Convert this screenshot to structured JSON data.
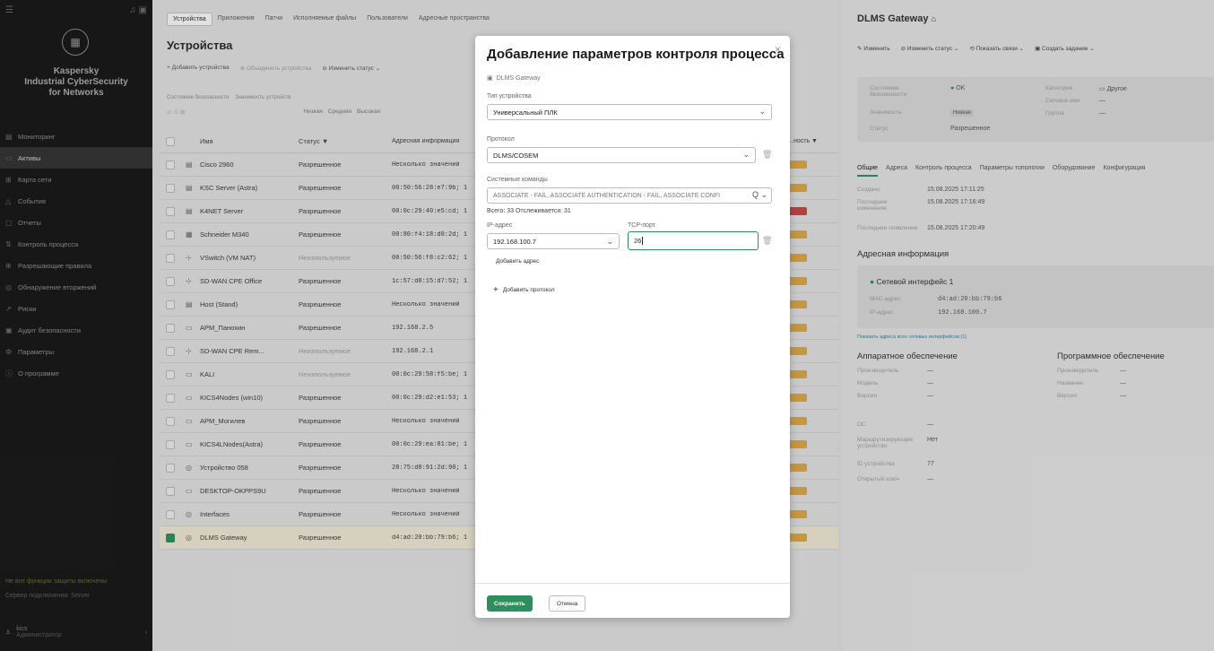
{
  "sidebar": {
    "brand": [
      "Kaspersky",
      "Industrial CyberSecurity",
      "for Networks"
    ],
    "items": [
      {
        "label": "Мониторинг",
        "icon": "monitor-icon"
      },
      {
        "label": "Активы",
        "icon": "assets-icon"
      },
      {
        "label": "Карта сети",
        "icon": "network-map-icon"
      },
      {
        "label": "События",
        "icon": "events-icon"
      },
      {
        "label": "Отчеты",
        "icon": "reports-icon"
      },
      {
        "label": "Контроль процесса",
        "icon": "process-icon"
      },
      {
        "label": "Разрешающие правила",
        "icon": "rules-icon"
      },
      {
        "label": "Обнаружение вторжений",
        "icon": "intrusion-icon"
      },
      {
        "label": "Риски",
        "icon": "risks-icon"
      },
      {
        "label": "Аудит безопасности",
        "icon": "audit-icon"
      },
      {
        "label": "Параметры",
        "icon": "settings-icon"
      },
      {
        "label": "О программе",
        "icon": "info-icon"
      }
    ],
    "warning": "Не все функции защиты включены",
    "server": "Сервер подключения: Server",
    "user_name": "kics",
    "user_role": "Администратор"
  },
  "main": {
    "tabs": [
      "Устройства",
      "Приложения",
      "Патчи",
      "Исполняемые файлы",
      "Пользователи",
      "Адресные пространства"
    ],
    "title": "Устройства",
    "toolbar": {
      "add": "Добавить устройства",
      "merge": "Объединить устройства",
      "change_status": "Изменить статус"
    },
    "filters": {
      "label1": "Состояние безопасности",
      "label2": "Значимость устройств",
      "low": "Низкая",
      "mid": "Средняя",
      "high": "Высокая"
    },
    "columns": {
      "name": "Имя",
      "status": "Статус",
      "address": "Адресная информация",
      "significance": "Значимость"
    },
    "rows": [
      {
        "name": "Cisco 2960",
        "status": "Разрешенное",
        "address": "Несколько значений",
        "grey": false
      },
      {
        "name": "KSC Server (Astra)",
        "status": "Разрешенное",
        "address": "00:50:56:28:e7:9b; 1",
        "grey": false
      },
      {
        "name": "K4NET Server",
        "status": "Разрешенное",
        "address": "00:0c:29:40:e5:cd; 1",
        "grey": false
      },
      {
        "name": "Schneider M340",
        "status": "Разрешенное",
        "address": "00:80:f4:18:d0:2d; 1",
        "grey": false
      },
      {
        "name": "VSwitch (VM NAT)",
        "status": "Неизпользуемое",
        "address": "00:50:56:f8:c2:62; 1",
        "grey": true
      },
      {
        "name": "SD-WAN CPE Office",
        "status": "Разрешенное",
        "address": "1c:57:d8:15:d7:52; 1",
        "grey": false
      },
      {
        "name": "Host (Stand)",
        "status": "Разрешенное",
        "address": "Несколько значений",
        "grey": false
      },
      {
        "name": "APM_Панохин",
        "status": "Разрешенное",
        "address": "192.168.2.5",
        "grey": false
      },
      {
        "name": "SD-WAN CPE Rem...",
        "status": "Неизпользуемое",
        "address": "192.168.2.1",
        "grey": true
      },
      {
        "name": "KALI",
        "status": "Неизпользуемое",
        "address": "00:0c:29:58:f5:be; 1",
        "grey": true
      },
      {
        "name": "KICS4Nodes (win10)",
        "status": "Разрешенное",
        "address": "00:0c:29:d2:e1:53; 1",
        "grey": false
      },
      {
        "name": "APM_Могилев",
        "status": "Разрешенное",
        "address": "Несколько значений",
        "grey": false
      },
      {
        "name": "KICS4LNodes(Astra)",
        "status": "Разрешенное",
        "address": "00:0c:29:ea:81:be; 1",
        "grey": false
      },
      {
        "name": "Устройство 058",
        "status": "Разрешенное",
        "address": "28:75:d8:91:2d:90; 1",
        "grey": false
      },
      {
        "name": "DESKTOP-OKPPS9U",
        "status": "Разрешенное",
        "address": "Несколько значений",
        "grey": false
      },
      {
        "name": "Interfaces",
        "status": "Разрешенное",
        "address": "Несколько значений",
        "grey": false
      },
      {
        "name": "DLMS Gateway",
        "status": "Разрешенное",
        "address": "d4:ad:20:bb:79:b6; 1",
        "grey": false,
        "selected": true
      }
    ]
  },
  "right": {
    "title": "DLMS Gateway",
    "toolbar": [
      "Изменить",
      "Изменить статус",
      "Показать связи",
      "Создать задание"
    ],
    "info": {
      "state_label": "Состояние безопасности",
      "state_value": "OK",
      "significance_label": "Значимость",
      "significance_value": "Низкая",
      "status_label": "Статус",
      "status_value": "Разрешенное",
      "category_label": "Категория",
      "category_value": "Другое",
      "netname_label": "Сетевое имя",
      "netname_value": "—",
      "group_label": "Группа",
      "group_value": "—"
    },
    "tabs": [
      "Общие",
      "Адреса",
      "Контроль процесса",
      "Параметры топологии",
      "Оборудование",
      "Конфигурация"
    ],
    "created_label": "Создано",
    "created_value": "15.08.2025 17:11:25",
    "modified_label": "Последнее изменение",
    "modified_value": "15.08.2025 17:16:49",
    "lastseen_label": "Последнее появление",
    "lastseen_value": "15.08.2025 17:20:49",
    "addr_section": "Адресная информация",
    "iface_title": "Сетевой интерфейс 1",
    "mac_label": "MAC-адрес",
    "mac_value": "d4:ad:20:bb:79:b6",
    "ip_label": "IP-адрес",
    "ip_value": "192.168.100.7",
    "show_all_link": "Показать адреса всех сетевых интерфейсов (1)",
    "hw_section": "Аппаратное обеспечение",
    "hw": [
      {
        "label": "Производитель",
        "value": "—"
      },
      {
        "label": "Модель",
        "value": "—"
      },
      {
        "label": "Версия",
        "value": "—"
      }
    ],
    "sw_section": "Программное обеспечение",
    "sw": [
      {
        "label": "Производитель",
        "value": "—"
      },
      {
        "label": "Название",
        "value": "—"
      },
      {
        "label": "Версия",
        "value": "—"
      }
    ],
    "extra": [
      {
        "label": "ОС",
        "value": "—"
      },
      {
        "label": "Маршрутизирующее устройство",
        "value": "Нет"
      },
      {
        "label": "ID устройства",
        "value": "77"
      },
      {
        "label": "Открытый ключ",
        "value": "—"
      }
    ]
  },
  "modal": {
    "title": "Добавление параметров контроля процесса",
    "device": "DLMS Gateway",
    "device_type_label": "Тип устройства",
    "device_type_value": "Универсальный ПЛК",
    "protocol_label": "Протокол",
    "protocol_value": "DLMS/COSEM",
    "commands_label": "Системные команды",
    "commands_value": "ASSOCIATE - FAIL, ASSOCIATE AUTHENTICATION - FAIL, ASSOCIATE CONFI",
    "count_text": "Всего: 33   Отслеживается: 31",
    "ip_label": "IP-адрес",
    "ip_value": "192.168.100.7",
    "port_label": "TCP-порт",
    "port_value": "26",
    "add_address": "Добавить адрес",
    "add_protocol": "Добавить протокол",
    "save": "Сохранить",
    "cancel": "Отмена"
  },
  "colors": {
    "accent": "#2c8f5e",
    "sidebar_bg": "#1a1a1a"
  }
}
